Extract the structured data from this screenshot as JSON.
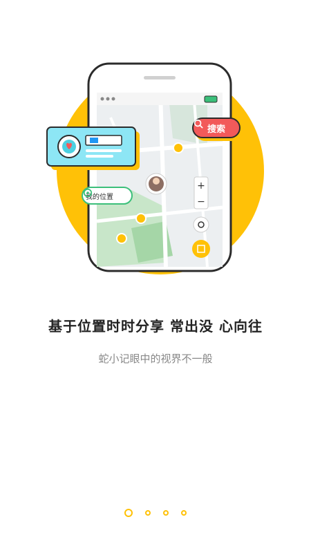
{
  "illustration": {
    "search_label": "搜索",
    "my_location_label": "我的位置",
    "colors": {
      "accent_yellow": "#ffc107",
      "search_red": "#f25a5a",
      "location_green": "#3bbf7a",
      "card_cyan": "#8de6f5"
    },
    "icons": [
      "search-icon",
      "target-icon",
      "heart-icon",
      "zoom-in-icon",
      "zoom-out-icon",
      "edit-icon"
    ]
  },
  "onboarding": {
    "title": "基于位置时时分享 常出没 心向往",
    "subtitle": "蛇小记眼中的视界不一般"
  },
  "pager": {
    "total": 4,
    "active_index": 0
  }
}
